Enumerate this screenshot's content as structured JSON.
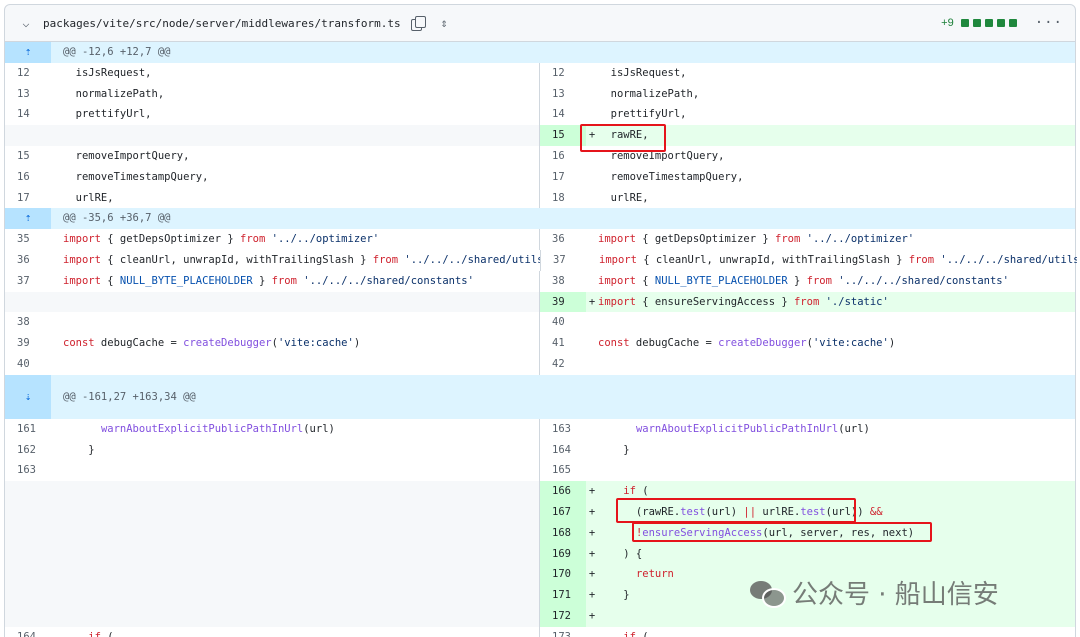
{
  "file": {
    "path": "packages/vite/src/node/server/middlewares/transform.ts",
    "additions": "+9",
    "diffstat_color": "#1f883d",
    "icons": {
      "toggle": "chevron-down-icon",
      "copy": "copy-icon",
      "expand": "unfold-icon",
      "more": "kebab-horizontal-icon"
    }
  },
  "rows": [
    {
      "type": "hunk",
      "text": "@@ -12,6 +12,7 @@",
      "icon": "expand-up-icon"
    },
    {
      "type": "ctx",
      "l": "12",
      "r": "12",
      "code": [
        {
          "t": "  isJsRequest,"
        }
      ]
    },
    {
      "type": "ctx",
      "l": "13",
      "r": "13",
      "code": [
        {
          "t": "  normalizePath,"
        }
      ]
    },
    {
      "type": "ctx",
      "l": "14",
      "r": "14",
      "code": [
        {
          "t": "  prettifyUrl,"
        }
      ]
    },
    {
      "type": "add",
      "r": "15",
      "code": [
        {
          "t": "  rawRE,"
        }
      ]
    },
    {
      "type": "ctx",
      "l": "15",
      "r": "16",
      "code": [
        {
          "t": "  removeImportQuery,"
        }
      ]
    },
    {
      "type": "ctx",
      "l": "16",
      "r": "17",
      "code": [
        {
          "t": "  removeTimestampQuery,"
        }
      ]
    },
    {
      "type": "ctx",
      "l": "17",
      "r": "18",
      "code": [
        {
          "t": "  urlRE,"
        }
      ]
    },
    {
      "type": "hunk",
      "text": "@@ -35,6 +36,7 @@",
      "icon": "unfold-icon"
    },
    {
      "type": "ctx",
      "l": "35",
      "r": "36",
      "code": [
        {
          "t": "import",
          "c": "kw"
        },
        {
          "t": " { getDepsOptimizer } "
        },
        {
          "t": "from",
          "c": "kw"
        },
        {
          "t": " "
        },
        {
          "t": "'../../optimizer'",
          "c": "str"
        }
      ]
    },
    {
      "type": "ctx",
      "l": "36",
      "r": "37",
      "code": [
        {
          "t": "import",
          "c": "kw"
        },
        {
          "t": " { cleanUrl, unwrapId, withTrailingSlash } "
        },
        {
          "t": "from",
          "c": "kw"
        },
        {
          "t": " "
        },
        {
          "t": "'../../../shared/utils'",
          "c": "str"
        }
      ]
    },
    {
      "type": "ctx",
      "l": "37",
      "r": "38",
      "code": [
        {
          "t": "import",
          "c": "kw"
        },
        {
          "t": " { "
        },
        {
          "t": "NULL_BYTE_PLACEHOLDER",
          "c": "const"
        },
        {
          "t": " } "
        },
        {
          "t": "from",
          "c": "kw"
        },
        {
          "t": " "
        },
        {
          "t": "'../../../shared/constants'",
          "c": "str"
        }
      ]
    },
    {
      "type": "add",
      "r": "39",
      "code": [
        {
          "t": "import",
          "c": "kw"
        },
        {
          "t": " { ensureServingAccess } "
        },
        {
          "t": "from",
          "c": "kw"
        },
        {
          "t": " "
        },
        {
          "t": "'./static'",
          "c": "str"
        }
      ]
    },
    {
      "type": "ctx",
      "l": "38",
      "r": "40",
      "code": [
        {
          "t": ""
        }
      ]
    },
    {
      "type": "ctx",
      "l": "39",
      "r": "41",
      "code": [
        {
          "t": "const",
          "c": "kw"
        },
        {
          "t": " debugCache = "
        },
        {
          "t": "createDebugger",
          "c": "fn"
        },
        {
          "t": "("
        },
        {
          "t": "'vite:cache'",
          "c": "str"
        },
        {
          "t": ")"
        }
      ]
    },
    {
      "type": "ctx",
      "l": "40",
      "r": "42",
      "code": [
        {
          "t": ""
        }
      ]
    },
    {
      "type": "hunk",
      "text": "@@ -161,27 +163,34 @@",
      "icon": "unfold-icon",
      "tall": true
    },
    {
      "type": "ctx",
      "l": "161",
      "r": "163",
      "code": [
        {
          "t": "      "
        },
        {
          "t": "warnAboutExplicitPublicPathInUrl",
          "c": "fn"
        },
        {
          "t": "(url)"
        }
      ]
    },
    {
      "type": "ctx",
      "l": "162",
      "r": "164",
      "code": [
        {
          "t": "    }"
        }
      ]
    },
    {
      "type": "ctx",
      "l": "163",
      "r": "165",
      "code": [
        {
          "t": ""
        }
      ]
    },
    {
      "type": "add",
      "r": "166",
      "code": [
        {
          "t": "    "
        },
        {
          "t": "if",
          "c": "kw"
        },
        {
          "t": " ("
        }
      ]
    },
    {
      "type": "add",
      "r": "167",
      "code": [
        {
          "t": "      (rawRE."
        },
        {
          "t": "test",
          "c": "fn"
        },
        {
          "t": "(url) "
        },
        {
          "t": "||",
          "c": "kw"
        },
        {
          "t": " urlRE."
        },
        {
          "t": "test",
          "c": "fn"
        },
        {
          "t": "(url)) "
        },
        {
          "t": "&&",
          "c": "kw"
        }
      ]
    },
    {
      "type": "add",
      "r": "168",
      "code": [
        {
          "t": "      "
        },
        {
          "t": "!",
          "c": "kw"
        },
        {
          "t": "ensureServingAccess",
          "c": "fn"
        },
        {
          "t": "(url, server, res, next)"
        }
      ]
    },
    {
      "type": "add",
      "r": "169",
      "code": [
        {
          "t": "    ) {"
        }
      ]
    },
    {
      "type": "add",
      "r": "170",
      "code": [
        {
          "t": "      "
        },
        {
          "t": "return",
          "c": "kw"
        }
      ]
    },
    {
      "type": "add",
      "r": "171",
      "code": [
        {
          "t": "    }"
        }
      ]
    },
    {
      "type": "add",
      "r": "172",
      "code": [
        {
          "t": ""
        }
      ]
    },
    {
      "type": "ctx",
      "l": "164",
      "r": "173",
      "code": [
        {
          "t": "    "
        },
        {
          "t": "if",
          "c": "kw"
        },
        {
          "t": " ("
        }
      ]
    }
  ],
  "watermark": {
    "text": "公众号 · 船山信安",
    "icon": "wechat-icon"
  },
  "highlight_color": "#e5141b"
}
